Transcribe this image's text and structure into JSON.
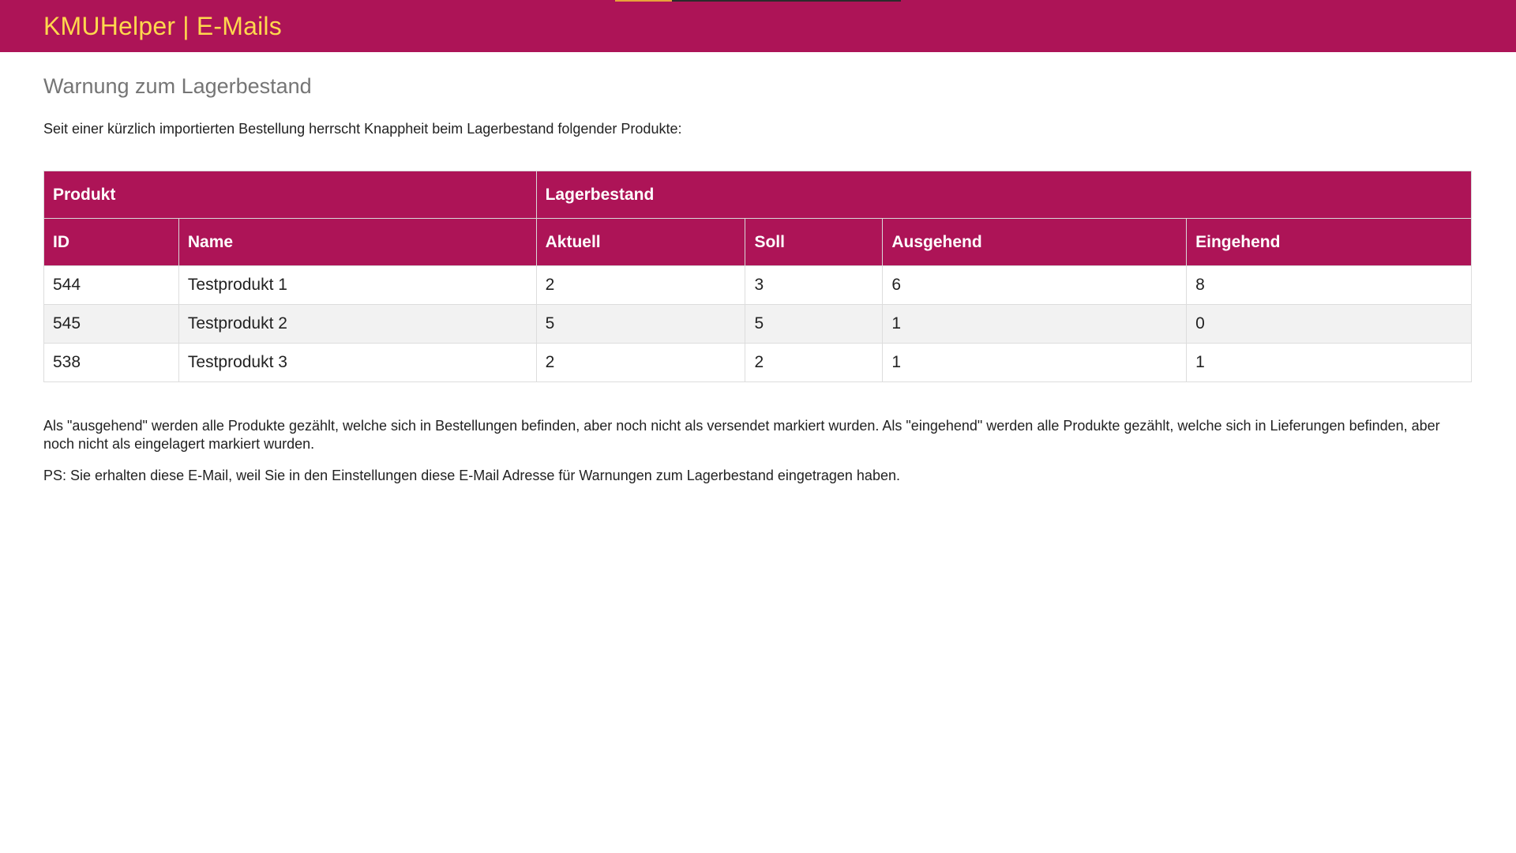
{
  "header": {
    "brand": "KMUHelper | E-Mails"
  },
  "page": {
    "title": "Warnung zum Lagerbestand",
    "intro": "Seit einer kürzlich importierten Bestellung herrscht Knappheit beim Lagerbestand folgender Produkte:"
  },
  "table": {
    "group_headers": {
      "product": "Produkt",
      "stock": "Lagerbestand"
    },
    "columns": {
      "id": "ID",
      "name": "Name",
      "current": "Aktuell",
      "target": "Soll",
      "outgoing": "Ausgehend",
      "incoming": "Eingehend"
    },
    "rows": [
      {
        "id": "544",
        "name": "Testprodukt 1",
        "current": "2",
        "target": "3",
        "outgoing": "6",
        "incoming": "8"
      },
      {
        "id": "545",
        "name": "Testprodukt 2",
        "current": "5",
        "target": "5",
        "outgoing": "1",
        "incoming": "0"
      },
      {
        "id": "538",
        "name": "Testprodukt 3",
        "current": "2",
        "target": "2",
        "outgoing": "1",
        "incoming": "1"
      }
    ]
  },
  "footer": {
    "note": "Als \"ausgehend\" werden alle Produkte gezählt, welche sich in Bestellungen befinden, aber noch nicht als versendet markiert wurden. Als \"eingehend\" werden alle Produkte gezählt, welche sich in Lieferungen befinden, aber noch nicht als eingelagert markiert wurden.",
    "ps": "PS: Sie erhalten diese E-Mail, weil Sie in den Einstellungen diese E-Mail Adresse für Warnungen zum Lagerbestand eingetragen haben."
  },
  "colors": {
    "brand_bar": "#ad1457",
    "brand_text": "#ffd84d",
    "title_gray": "#757575",
    "row_stripe": "#f2f2f2"
  }
}
